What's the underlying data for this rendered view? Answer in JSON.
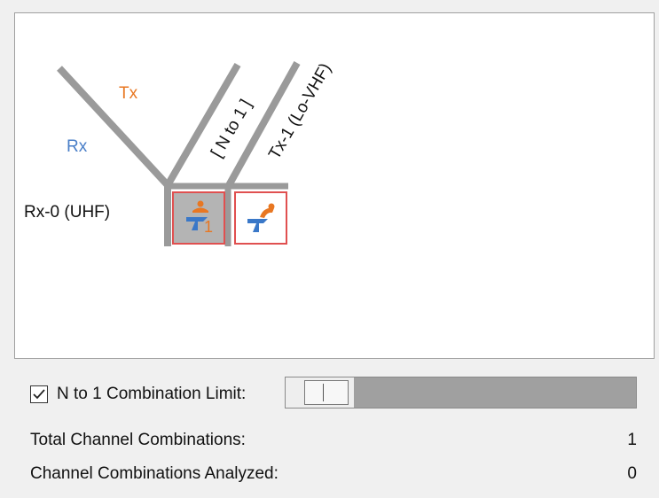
{
  "diagram": {
    "label_tx": "Tx",
    "label_rx": "Rx",
    "column_1_label": "[ N to 1 ]",
    "column_2_label": "Tx-1 (Lo-VHF)",
    "row_label": "Rx-0 (UHF)",
    "cell_1_badge": "1",
    "colors": {
      "tx": "#e87722",
      "rx": "#4a7fc8",
      "line": "#9a9a9a",
      "cell_border": "#e05050",
      "cell_fill_selected": "#b4b4b4",
      "icon_orange": "#e87722",
      "icon_blue": "#3a78c8"
    }
  },
  "controls": {
    "combination_limit_checked": true,
    "combination_limit_label": "N to 1 Combination Limit:",
    "combination_limit_slider_level": 0.16
  },
  "stats": [
    {
      "label": "Total Channel Combinations:",
      "value": "1"
    },
    {
      "label": "Channel Combinations Analyzed:",
      "value": "0"
    }
  ]
}
